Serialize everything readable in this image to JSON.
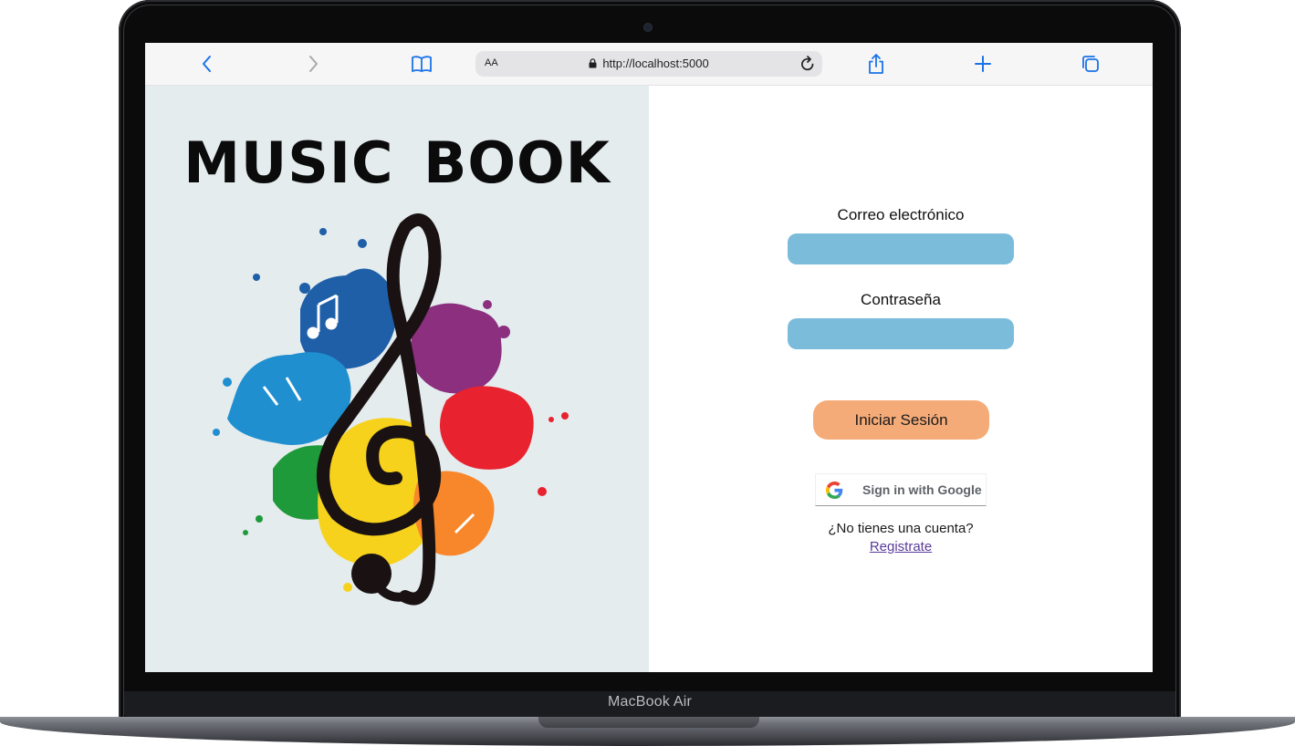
{
  "device": {
    "model_label": "MacBook Air"
  },
  "browser": {
    "text_size_label": "AA",
    "url": "http://localhost:5000",
    "icons": {
      "back": "chevron-left-icon",
      "forward": "chevron-right-icon",
      "bookmarks": "book-icon",
      "lock": "lock-icon",
      "reload": "reload-icon",
      "share": "share-icon",
      "new_tab": "plus-icon",
      "tabs": "tabs-icon"
    },
    "accent_color": "#1a73e8"
  },
  "brand": {
    "title": "MUSIC BOOK",
    "art": "treble-clef-paint-splash"
  },
  "login": {
    "email_label": "Correo electrónico",
    "email_value": "",
    "password_label": "Contraseña",
    "password_value": "",
    "submit_label": "Iniciar Sesión",
    "google_label": "Sign in with Google",
    "no_account_text": "¿No tienes una cuenta?",
    "register_link": "Registrate",
    "colors": {
      "input_bg": "#7cbcdb",
      "button_bg": "#f4ab78",
      "left_panel_bg": "#e4ecee"
    }
  }
}
